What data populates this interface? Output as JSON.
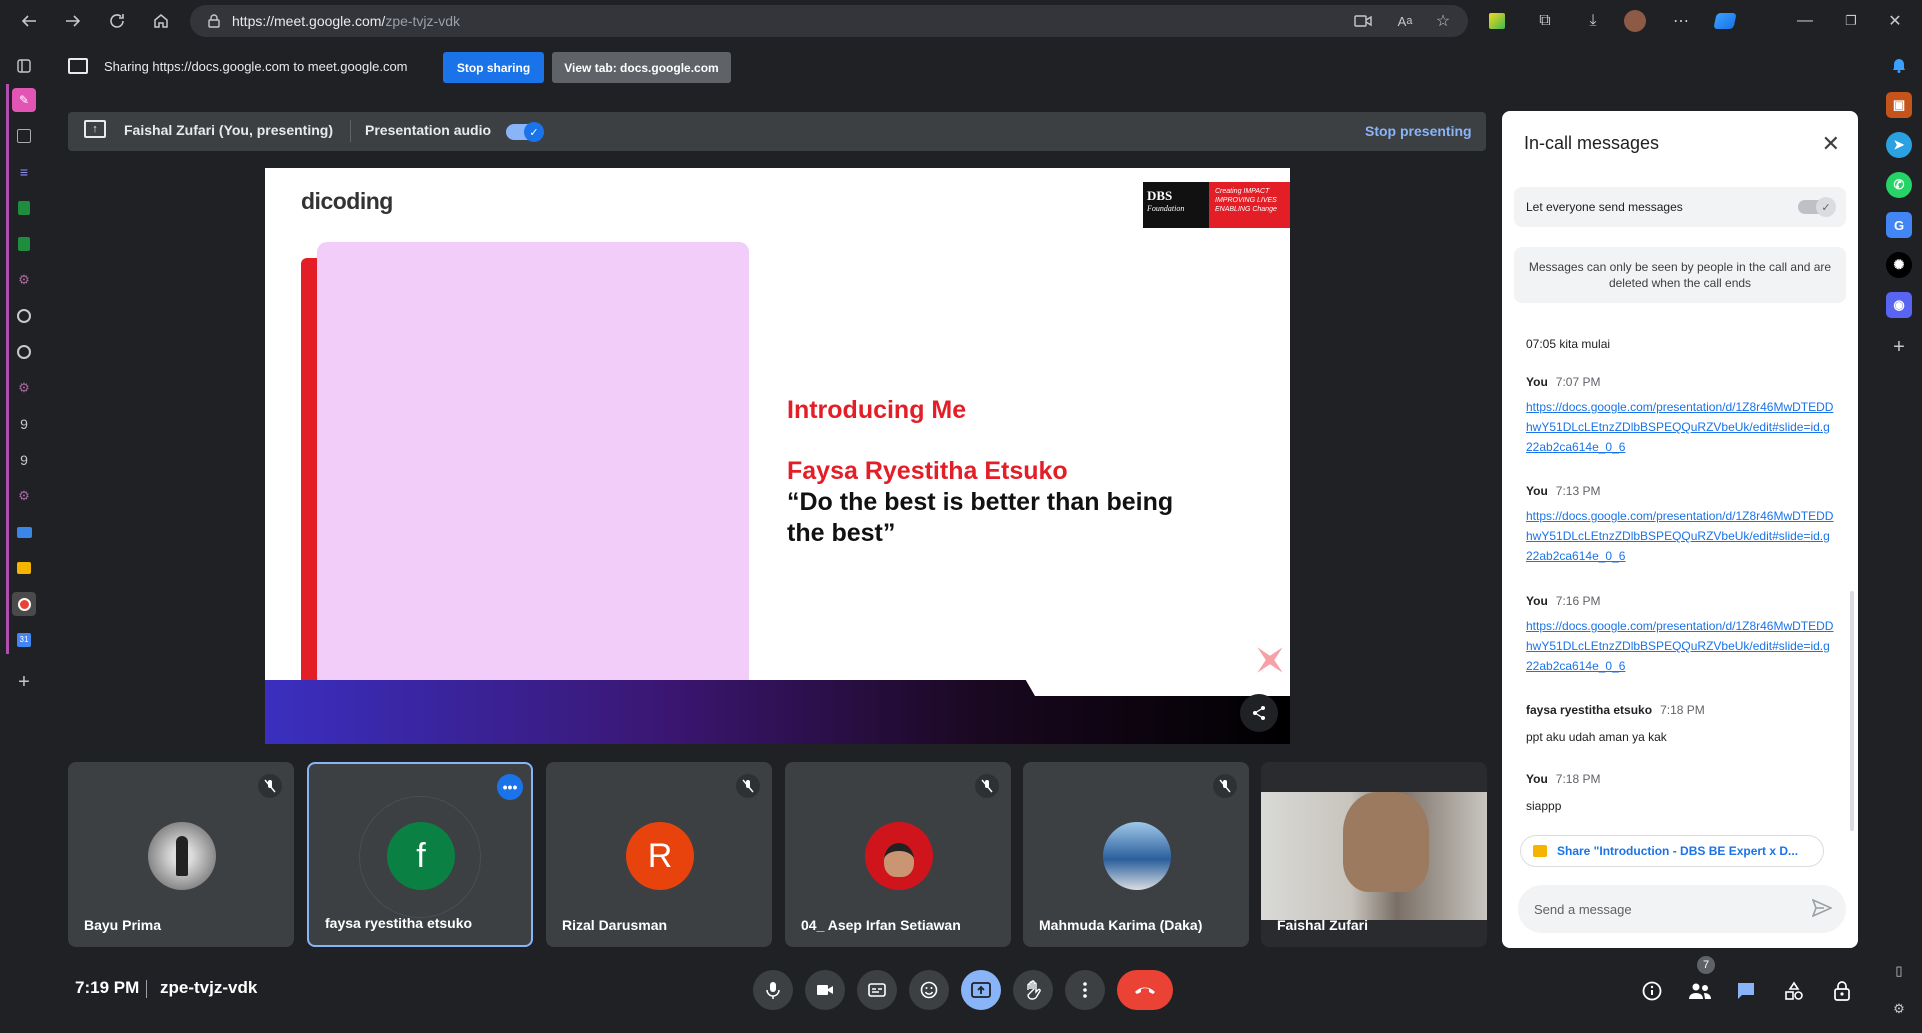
{
  "browser": {
    "url_host": "https://meet.google.com/",
    "url_path": "zpe-tvjz-vdk"
  },
  "share_bar": {
    "text": "Sharing https://docs.google.com to meet.google.com",
    "stop_label": "Stop sharing",
    "view_tab_label": "View tab: docs.google.com"
  },
  "presenter_bar": {
    "name": "Faishal Zufari (You, presenting)",
    "audio_label": "Presentation audio",
    "stop_label": "Stop presenting"
  },
  "slide": {
    "logo_text": "dicoding",
    "sponsor_text": "DBS",
    "sponsor_sub": "Foundation",
    "tagline": "Creating IMPACT IMPROVING LIVES ENABLING Change",
    "title": "Introducing Me",
    "name": "Faysa Ryestitha Etsuko",
    "quote": "“Do the best is better than being the best”"
  },
  "participants": [
    {
      "name": "Bayu Prima",
      "initial": "",
      "muted": true
    },
    {
      "name": "faysa ryestitha etsuko",
      "initial": "f",
      "muted": false
    },
    {
      "name": "Rizal Darusman",
      "initial": "R",
      "muted": true
    },
    {
      "name": "04_ Asep Irfan Setiawan",
      "initial": "",
      "muted": true
    },
    {
      "name": "Mahmuda Karima (Daka)",
      "initial": "",
      "muted": true
    },
    {
      "name": "Faishal Zufari",
      "initial": "",
      "muted": false
    }
  ],
  "chat": {
    "title": "In-call messages",
    "toggle_label": "Let everyone send messages",
    "note": "Messages can only be seen by people in the call and are deleted when the call ends",
    "messages": [
      {
        "sender": "",
        "time": "",
        "text": "07:05 kita mulai"
      },
      {
        "sender": "You",
        "time": "7:07 PM",
        "link": "https://docs.google.com/presentation/d/1Z8r46MwDTEDDhwY51DLcLEtnzZDlbBSPEQQuRZVbeUk/edit#slide=id.g22ab2ca614e_0_6"
      },
      {
        "sender": "You",
        "time": "7:13 PM",
        "link": "https://docs.google.com/presentation/d/1Z8r46MwDTEDDhwY51DLcLEtnzZDlbBSPEQQuRZVbeUk/edit#slide=id.g22ab2ca614e_0_6"
      },
      {
        "sender": "You",
        "time": "7:16 PM",
        "link": "https://docs.google.com/presentation/d/1Z8r46MwDTEDDhwY51DLcLEtnzZDlbBSPEQQuRZVbeUk/edit#slide=id.g22ab2ca614e_0_6"
      },
      {
        "sender": "faysa ryestitha etsuko",
        "time": "7:18 PM",
        "text": "ppt aku udah aman ya kak"
      },
      {
        "sender": "You",
        "time": "7:18 PM",
        "text": "siappp"
      }
    ],
    "share_chip": "Share \"Introduction - DBS BE Expert x D...",
    "send_placeholder": "Send a message"
  },
  "bottom": {
    "time": "7:19 PM",
    "meeting_code": "zpe-tvjz-vdk",
    "people_count": "7"
  },
  "colors": {
    "accent": "#1a73e8",
    "end_call": "#ea4335",
    "slide_red": "#e31e26",
    "present_active": "#8ab4f8"
  }
}
